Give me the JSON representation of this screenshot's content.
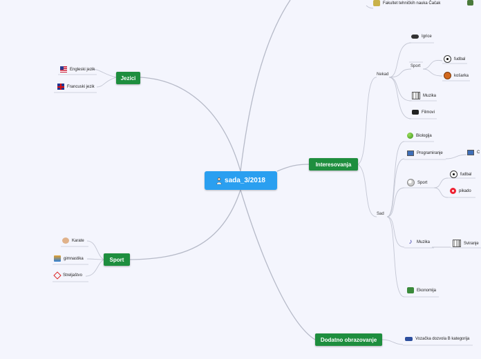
{
  "central": {
    "label": "sada_3/2018",
    "icon": "person-icon"
  },
  "branches": {
    "jezici": {
      "label": "Jezici",
      "items": [
        {
          "label": "Engleski jezik",
          "icon": "us-flag-icon"
        },
        {
          "label": "Francuski jezik",
          "icon": "uk-flag-icon"
        }
      ]
    },
    "sport": {
      "label": "Sport",
      "items": [
        {
          "label": "Karate",
          "icon": "karate-icon"
        },
        {
          "label": "gimnastika",
          "icon": "gymnastics-icon"
        },
        {
          "label": "Streljaštvo",
          "icon": "shooting-icon"
        }
      ]
    },
    "interesovanja": {
      "label": "Interesovanja",
      "nekad": {
        "label": "Nekad",
        "igrice": "Igrice",
        "sport": {
          "label": "Sport",
          "fudbal": "fudbal",
          "kosarka": "košarka"
        },
        "muzika": "Muzika",
        "filmovi": "Filmovi"
      },
      "sad": {
        "label": "Sad",
        "biologija": "Biologija",
        "programiranje": "Programiranje",
        "programiranje_child": "C",
        "sport": {
          "label": "Sport",
          "fudbal": "fudbal",
          "pikado": "pikado"
        },
        "muzika": "Muzika",
        "sviranje": "Sviranje",
        "ekonomija": "Ekonomija"
      }
    },
    "dodatno": {
      "label": "Dodatno obrazovanje",
      "items": [
        {
          "label": "Vozačka dozvola B kategorija",
          "icon": "car-icon"
        }
      ]
    },
    "top": {
      "label": "Fakultet tehničkih nauka Čačak"
    }
  },
  "colors": {
    "central": "#2a9ff0",
    "main": "#1e8e3e",
    "link": "#b0b4c4",
    "background": "#f4f5fd"
  }
}
